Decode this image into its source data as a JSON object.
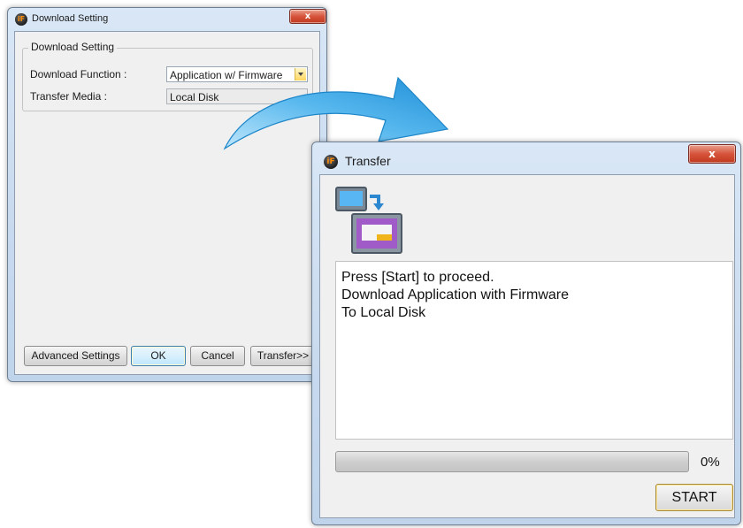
{
  "download_setting_window": {
    "title": "Download Setting",
    "close_label": "x",
    "group_title": "Download Setting",
    "download_function_label": "Download Function :",
    "download_function_value": "Application w/ Firmware",
    "transfer_media_label": "Transfer Media :",
    "transfer_media_value": "Local Disk",
    "buttons": {
      "advanced": "Advanced Settings",
      "ok": "OK",
      "cancel": "Cancel",
      "transfer": "Transfer>>"
    }
  },
  "transfer_window": {
    "title": "Transfer",
    "close_label": "x",
    "messages": [
      "Press [Start] to proceed.",
      "Download Application with Firmware",
      "To Local Disk"
    ],
    "progress_percent": 0,
    "progress_label": "0%",
    "start_label": "START"
  },
  "app_icon_text": "iF",
  "colors": {
    "title_bar": "#c7d9ee",
    "close_button": "#d6543b",
    "arrow": "#3aa6e6",
    "progress_fill": "#06b025"
  },
  "icons": [
    "app-logo-icon",
    "transfer-icon",
    "close-icon",
    "dropdown-arrow-icon",
    "curved-arrow-icon"
  ]
}
